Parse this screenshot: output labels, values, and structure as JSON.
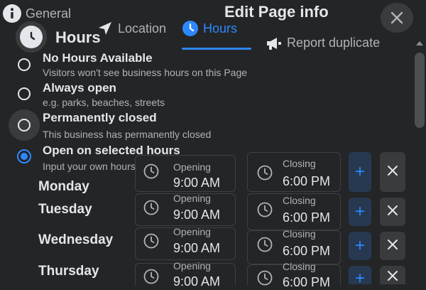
{
  "header": {
    "title": "Edit Page info",
    "close_icon": "close-icon"
  },
  "tabs": {
    "general": "General",
    "location": "Location",
    "hours": "Hours",
    "report": "Report duplicate"
  },
  "section": {
    "title": "Hours"
  },
  "options": [
    {
      "label": "No Hours Available",
      "desc": "Visitors won't see business hours on this Page"
    },
    {
      "label": "Always open",
      "desc": "e.g. parks, beaches, streets"
    },
    {
      "label": "Permanently closed",
      "desc": "This business has permanently closed"
    },
    {
      "label": "Open on selected hours",
      "desc": "Input your own hours"
    }
  ],
  "selected_option": "Open on selected hours",
  "schedule": [
    {
      "day": "Monday",
      "opening_label": "Opening",
      "opening": "9:00 AM",
      "closing_label": "Closing",
      "closing": "6:00 PM"
    },
    {
      "day": "Tuesday",
      "opening_label": "Opening",
      "opening": "9:00 AM",
      "closing_label": "Closing",
      "closing": "6:00 PM"
    },
    {
      "day": "Wednesday",
      "opening_label": "Opening",
      "opening": "9:00 AM",
      "closing_label": "Closing",
      "closing": "6:00 PM"
    },
    {
      "day": "Thursday",
      "opening_label": "Opening",
      "opening": "9:00 AM",
      "closing_label": "Closing",
      "closing": "6:00 PM"
    }
  ],
  "buttons": {
    "add": "+"
  },
  "colors": {
    "background": "#242526",
    "accent": "#2d88ff",
    "text": "#e4e6eb",
    "muted": "#b0b3b8"
  }
}
